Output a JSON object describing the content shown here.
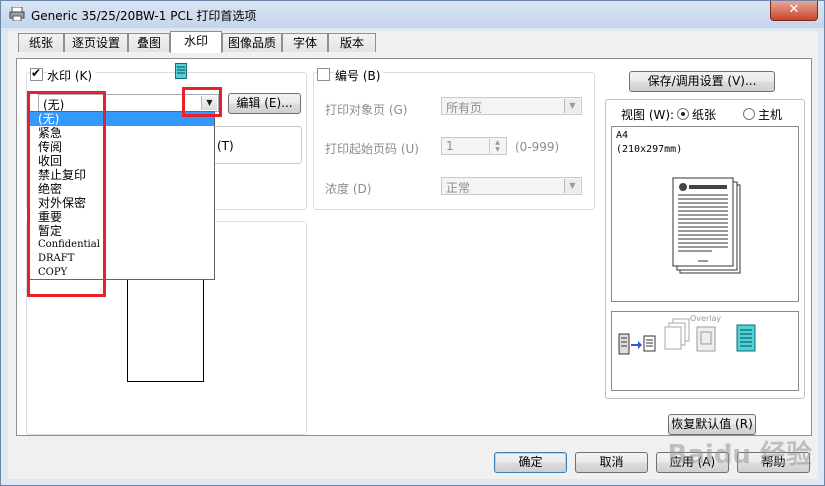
{
  "window": {
    "title": "Generic 35/25/20BW-1 PCL 打印首选项",
    "close_label": "✕"
  },
  "tabs": [
    "纸张",
    "逐页设置",
    "叠图",
    "水印",
    "图像品质",
    "字体",
    "版本"
  ],
  "watermark": {
    "checkbox_label": "水印 (K)",
    "checked": true,
    "selected": "(无)",
    "edit_button": "编辑 (E)...",
    "hidden_option_suffix": "(T)",
    "options": [
      "(无)",
      "紧急",
      "传阅",
      "收回",
      "禁止复印",
      "绝密",
      "对外保密",
      "重要",
      "暂定",
      "Confidential",
      "DRAFT",
      "COPY"
    ]
  },
  "numbering": {
    "checkbox_label": "编号 (B)",
    "checked": false,
    "target_label": "打印对象页 (G)",
    "target_value": "所有页",
    "start_label": "打印起始页码 (U)",
    "start_value": "1",
    "start_range": "(0-999)",
    "density_label": "浓度 (D)",
    "density_value": "正常"
  },
  "right_panel": {
    "save_button": "保存/调用设置 (V)...",
    "view_label": "视图 (W):",
    "view_paper": "纸张",
    "view_host": "主机",
    "paper_size": "A4",
    "paper_dims": "(210x297mm)",
    "overlay_label": "Overlay",
    "restore_button": "恢复默认值 (R)"
  },
  "footer": {
    "ok": "确定",
    "cancel": "取消",
    "apply": "应用 (A)",
    "help": "帮助"
  },
  "brand_watermark": "Baidu 经验"
}
